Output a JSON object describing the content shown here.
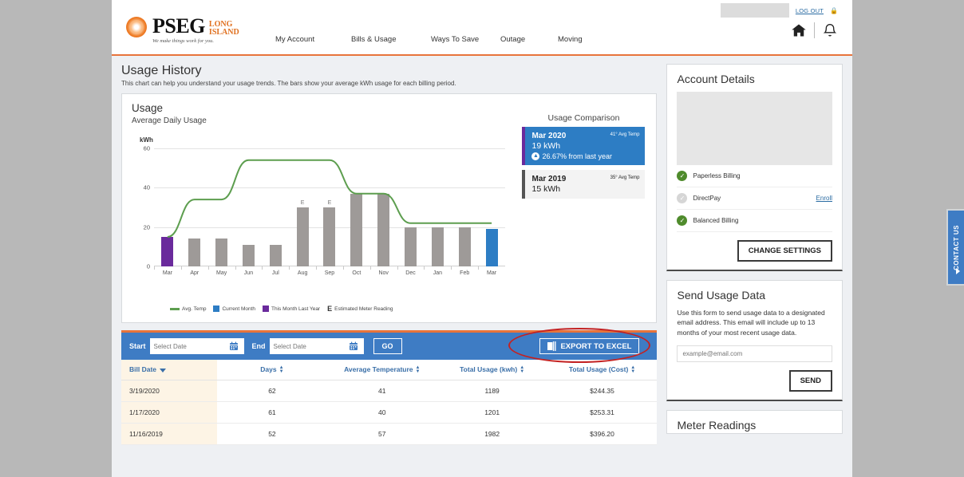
{
  "header": {
    "logo": {
      "brand": "PSEG",
      "region_line1": "LONG",
      "region_line2": "ISLAND",
      "tagline": "We make things work for you."
    },
    "logout_label": "LOG OUT",
    "nav": [
      {
        "label": "My Account"
      },
      {
        "label": "Bills & Usage"
      },
      {
        "label": "Ways To Save"
      },
      {
        "label": "Outage"
      },
      {
        "label": "Moving"
      }
    ],
    "icons": {
      "home": "home-icon",
      "bell": "bell-icon",
      "lock": "lock-icon"
    },
    "accent_color": "#e8743b"
  },
  "page": {
    "title": "Usage History",
    "subtitle": "This chart can help you understand your usage trends. The bars show your average kWh usage for each billing period."
  },
  "usage_card": {
    "heading": "Usage",
    "subheading": "Average Daily Usage",
    "y_axis_label": "kWh",
    "legend": [
      {
        "label": "Avg. Temp",
        "type": "line",
        "color": "#5d9e4f"
      },
      {
        "label": "Current Month",
        "type": "box",
        "color": "#2d7dc4"
      },
      {
        "label": "This Month Last Year",
        "type": "box",
        "color": "#6a2a9c"
      },
      {
        "label": "Estimated Meter Reading",
        "type": "glyph",
        "glyph": "E"
      }
    ]
  },
  "chart_data": {
    "type": "bar",
    "title": "Average Daily Usage",
    "xlabel": "",
    "ylabel": "kWh",
    "ylim": [
      0,
      60
    ],
    "yticks": [
      0,
      20,
      40,
      60
    ],
    "grid": true,
    "legend_position": "bottom",
    "categories": [
      "Mar",
      "Apr",
      "May",
      "Jun",
      "Jul",
      "Aug",
      "Sep",
      "Oct",
      "Nov",
      "Dec",
      "Jan",
      "Feb",
      "Mar"
    ],
    "series": [
      {
        "name": "Average Daily Usage (kWh)",
        "type": "bar",
        "values": [
          15,
          14,
          14,
          11,
          11,
          30,
          30,
          37,
          37,
          20,
          20,
          20,
          19
        ],
        "bar_colors": [
          "#6a2a9c",
          "#9e9a98",
          "#9e9a98",
          "#9e9a98",
          "#9e9a98",
          "#9e9a98",
          "#9e9a98",
          "#9e9a98",
          "#9e9a98",
          "#9e9a98",
          "#9e9a98",
          "#9e9a98",
          "#2d7dc4"
        ],
        "annotations": [
          {
            "category": "Aug",
            "label": "E"
          },
          {
            "category": "Sep",
            "label": "E"
          }
        ]
      },
      {
        "name": "Avg. Temp",
        "type": "line",
        "color": "#5d9e4f",
        "values": [
          15,
          34,
          34,
          54,
          54,
          54,
          54,
          37,
          37,
          22,
          22,
          22,
          22
        ]
      }
    ]
  },
  "comparison": {
    "heading": "Usage Comparison",
    "rows": [
      {
        "month": "Mar 2020",
        "usage": "19 kWh",
        "temp": "41° Avg Temp",
        "delta": "26.67% from last year",
        "delta_direction": "up",
        "highlight": true
      },
      {
        "month": "Mar 2019",
        "usage": "15 kWh",
        "temp": "35° Avg Temp",
        "delta": "",
        "delta_direction": "",
        "highlight": false
      }
    ]
  },
  "toolbar": {
    "start_label": "Start",
    "end_label": "End",
    "start_value": "",
    "start_placeholder": "Select Date",
    "end_value": "",
    "end_placeholder": "Select Date",
    "go_label": "GO",
    "export_label": "EXPORT TO EXCEL",
    "background_color": "#3e7cc4",
    "annotation_color": "#c32222"
  },
  "table": {
    "columns": [
      {
        "label": "Bill Date",
        "sorted": true,
        "sort_dir": "desc"
      },
      {
        "label": "Days",
        "sorted": false
      },
      {
        "label": "Average Temperature",
        "sorted": false
      },
      {
        "label": "Total Usage (kwh)",
        "sorted": false
      },
      {
        "label": "Total Usage (Cost)",
        "sorted": false
      }
    ],
    "rows": [
      {
        "bill_date": "3/19/2020",
        "days": "62",
        "avg_temp": "41",
        "usage_kwh": "1189",
        "usage_cost": "$244.35"
      },
      {
        "bill_date": "1/17/2020",
        "days": "61",
        "avg_temp": "40",
        "usage_kwh": "1201",
        "usage_cost": "$253.31"
      },
      {
        "bill_date": "11/16/2019",
        "days": "52",
        "avg_temp": "57",
        "usage_kwh": "1982",
        "usage_cost": "$396.20"
      }
    ]
  },
  "account_details": {
    "heading": "Account Details",
    "features": [
      {
        "label": "Paperless Billing",
        "enabled": true,
        "action": ""
      },
      {
        "label": "DirectPay",
        "enabled": false,
        "action": "Enroll"
      },
      {
        "label": "Balanced Billing",
        "enabled": true,
        "action": ""
      }
    ],
    "button_label": "CHANGE SETTINGS"
  },
  "send_usage": {
    "heading": "Send Usage Data",
    "body": "Use this form to send usage data to a designated email address. This email will include up to 13 months of your most recent usage data.",
    "email_value": "",
    "email_placeholder": "example@email.com",
    "button_label": "SEND"
  },
  "meter_readings": {
    "heading": "Meter Readings"
  },
  "contact_tab": {
    "label": "CONTACT US"
  }
}
